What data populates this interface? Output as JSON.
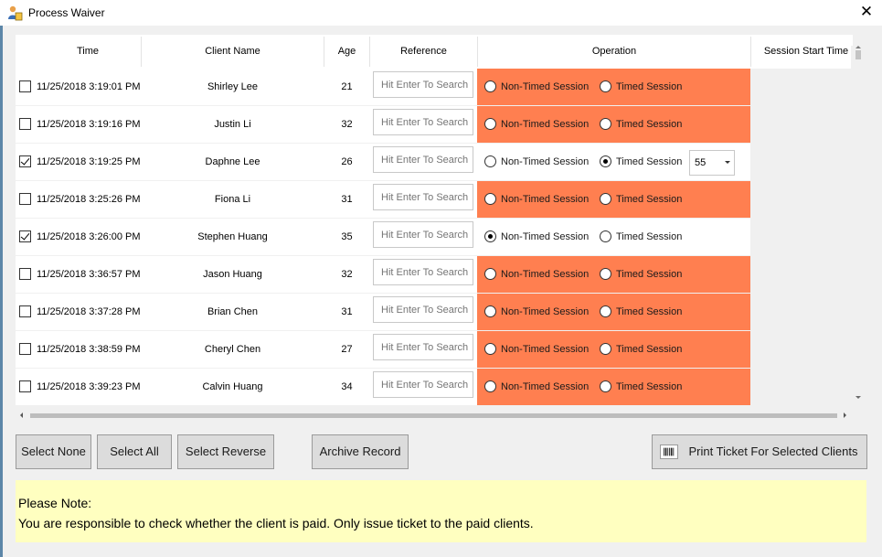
{
  "window": {
    "title": "Process Waiver",
    "close_label": "✕"
  },
  "table": {
    "columns": [
      "Time",
      "Client Name",
      "Age",
      "Reference",
      "Operation",
      "Session Start Time"
    ],
    "reference_placeholder": "Hit Enter To Search",
    "option_non_timed": "Non-Timed Session",
    "option_timed": "Timed Session",
    "rows": [
      {
        "checked": false,
        "time": "11/25/2018 3:19:01 PM",
        "name": "Shirley Lee",
        "age": "21",
        "highlight": true,
        "selection": "none",
        "duration": ""
      },
      {
        "checked": false,
        "time": "11/25/2018 3:19:16 PM",
        "name": "Justin Li",
        "age": "32",
        "highlight": true,
        "selection": "none",
        "duration": ""
      },
      {
        "checked": true,
        "time": "11/25/2018 3:19:25 PM",
        "name": "Daphne Lee",
        "age": "26",
        "highlight": false,
        "selection": "timed",
        "duration": "55"
      },
      {
        "checked": false,
        "time": "11/25/2018 3:25:26 PM",
        "name": "Fiona  Li",
        "age": "31",
        "highlight": true,
        "selection": "none",
        "duration": ""
      },
      {
        "checked": true,
        "time": "11/25/2018 3:26:00 PM",
        "name": "Stephen Huang",
        "age": "35",
        "highlight": false,
        "selection": "non-timed",
        "duration": ""
      },
      {
        "checked": false,
        "time": "11/25/2018 3:36:57 PM",
        "name": "Jason Huang",
        "age": "32",
        "highlight": true,
        "selection": "none",
        "duration": ""
      },
      {
        "checked": false,
        "time": "11/25/2018 3:37:28 PM",
        "name": "Brian Chen",
        "age": "31",
        "highlight": true,
        "selection": "none",
        "duration": ""
      },
      {
        "checked": false,
        "time": "11/25/2018 3:38:59 PM",
        "name": "Cheryl Chen",
        "age": "27",
        "highlight": true,
        "selection": "none",
        "duration": ""
      },
      {
        "checked": false,
        "time": "11/25/2018 3:39:23 PM",
        "name": "Calvin Huang",
        "age": "34",
        "highlight": true,
        "selection": "none",
        "duration": ""
      }
    ]
  },
  "buttons": {
    "select_none": "Select None",
    "select_all": "Select All",
    "select_reverse": "Select Reverse",
    "archive_record": "Archive Record",
    "print_ticket": "Print Ticket For Selected Clients"
  },
  "note": {
    "heading": "Please Note:",
    "message": "You are responsible to check whether the client is paid. Only issue ticket to the paid clients."
  },
  "colors": {
    "highlight": "#ff7f50",
    "note_bg": "#ffffc0"
  }
}
